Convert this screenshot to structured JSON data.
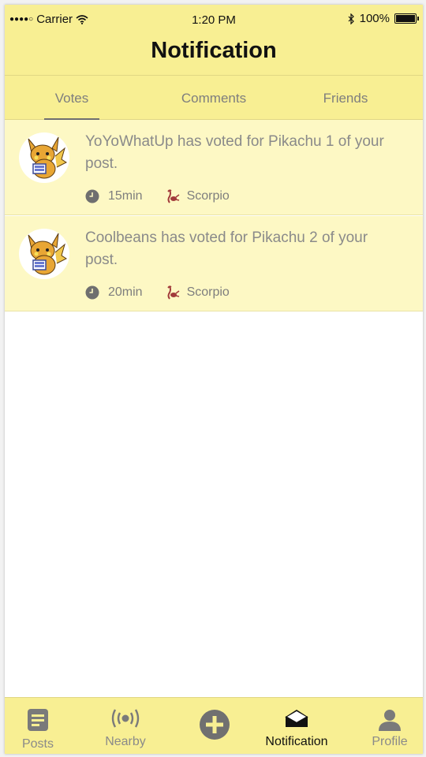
{
  "status_bar": {
    "carrier": "Carrier",
    "time": "1:20 PM",
    "battery": "100%"
  },
  "header": {
    "title": "Notification"
  },
  "tabs": [
    {
      "label": "Votes",
      "active": true
    },
    {
      "label": "Comments",
      "active": false
    },
    {
      "label": "Friends",
      "active": false
    }
  ],
  "notifications": [
    {
      "message": "YoYoWhatUp has voted for Pikachu 1 of your post.",
      "time": "15min",
      "sign": "Scorpio"
    },
    {
      "message": "Coolbeans has voted for Pikachu 2 of your post.",
      "time": "20min",
      "sign": "Scorpio"
    }
  ],
  "tabbar": [
    {
      "label": "Posts",
      "icon": "posts-icon"
    },
    {
      "label": "Nearby",
      "icon": "broadcast-icon"
    },
    {
      "label": "",
      "icon": "add-icon"
    },
    {
      "label": "Notification",
      "icon": "envelope-open-icon",
      "active": true
    },
    {
      "label": "Profile",
      "icon": "person-icon"
    }
  ],
  "colors": {
    "accent": "#f8ef93",
    "row": "#fdf8c4",
    "text_muted": "#8a8a8a",
    "scorpio": "#a23b3b"
  }
}
